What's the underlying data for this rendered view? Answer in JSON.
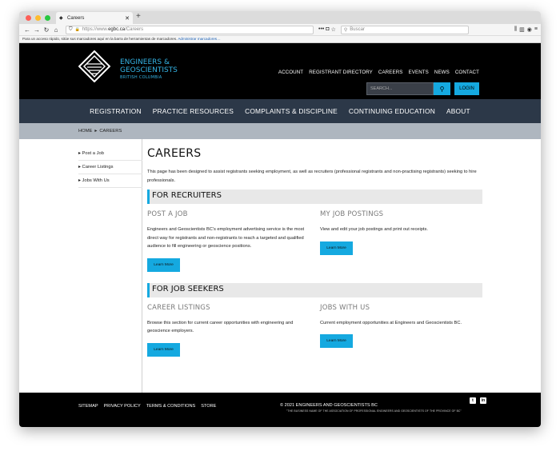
{
  "browser": {
    "tab_title": "Careers",
    "url_prefix": "https://www.",
    "url_domain": "egbc.ca",
    "url_path": "/Careers",
    "search_placeholder": "Buscar",
    "bookmarks_text": "Para un acceso rápido, sitúe sus marcadores aquí en la barra de herramientas de marcadores.",
    "bookmarks_link": "Administrar marcadores…",
    "colors": {
      "close": "#fe5f57",
      "min": "#febc2e",
      "max": "#28c840"
    }
  },
  "header": {
    "logo_line1": "ENGINEERS &",
    "logo_line2": "GEOSCIENTISTS",
    "logo_sub": "BRITISH COLUMBIA",
    "search_placeholder": "SEARCH...",
    "login_label": "LOGIN",
    "top_nav": [
      "ACCOUNT",
      "REGISTRANT DIRECTORY",
      "CAREERS",
      "EVENTS",
      "NEWS",
      "CONTACT"
    ]
  },
  "main_nav": [
    "REGISTRATION",
    "PRACTICE RESOURCES",
    "COMPLAINTS & DISCIPLINE",
    "CONTINUING EDUCATION",
    "ABOUT"
  ],
  "breadcrumb": {
    "home": "HOME",
    "current": "CAREERS"
  },
  "sidebar": [
    "Post a Job",
    "Career Listings",
    "Jobs With Us"
  ],
  "page": {
    "title": "CAREERS",
    "intro": "This page has been designed to assist registrants seeking employment, as well as recruiters (professional registrants and non-practising registrants) seeking to hire professionals.",
    "recruiters_heading": "FOR RECRUITERS",
    "post_job_title": "POST A JOB",
    "post_job_text": "Engineers and Geoscientists BC's employment advertising service is the most direct way for registrants and non-registrants to reach a targeted and qualified audience to fill engineering or geoscience positions.",
    "my_postings_title": "MY JOB POSTINGS",
    "my_postings_text": "View and edit your job postings and print out receipts.",
    "seekers_heading": "FOR JOB SEEKERS",
    "listings_title": "CAREER LISTINGS",
    "listings_text": "Browse this section for current career opportunities with engineering and geoscience employers.",
    "jobs_with_us_title": "JOBS WITH US",
    "jobs_with_us_text": "Current employment opportunities at Engineers and Geoscientists BC.",
    "learn_more": "Learn More"
  },
  "footer": {
    "links": [
      "SITEMAP",
      "PRIVACY POLICY",
      "TERMS & CONDITIONS",
      "STORE"
    ],
    "copyright": "© 2021 ENGINEERS AND GEOSCIENTISTS BC",
    "tagline": "\"THE BUSINESS NAME OF THE ASSOCIATION OF PROFESSIONAL ENGINEERS AND GEOSCIENTISTS OF THE PROVINCE OF BC\"",
    "social": [
      "twitter-icon",
      "linkedin-icon"
    ]
  }
}
